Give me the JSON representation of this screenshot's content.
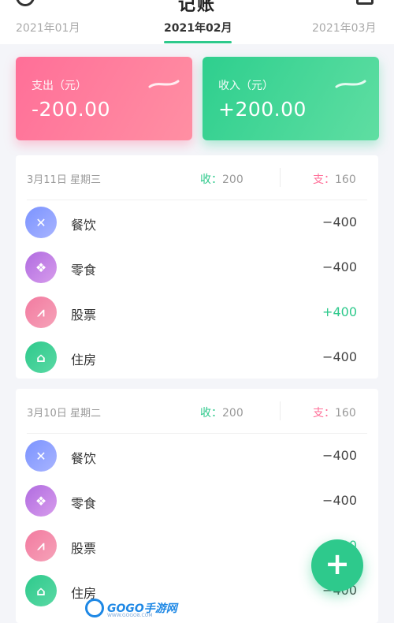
{
  "header": {
    "title": "记账",
    "tabs": [
      "2021年01月",
      "2021年02月",
      "2021年03月"
    ],
    "active_tab": 1
  },
  "summary": {
    "expense": {
      "label": "支出（元）",
      "value": "-200.00"
    },
    "income": {
      "label": "收入（元）",
      "value": "+200.00"
    }
  },
  "days": [
    {
      "date": "3月11日 星期三",
      "income_key": "收：",
      "income_val": "200",
      "expense_key": "支：",
      "expense_val": "160",
      "items": [
        {
          "label": "餐饮",
          "amount": "−400",
          "icon": "utensils-icon",
          "icon_glyph": "✕"
        },
        {
          "label": "零食",
          "amount": "−400",
          "icon": "candy-icon",
          "icon_glyph": "❖"
        },
        {
          "label": "股票",
          "amount": "+400",
          "icon": "stock-chart-icon",
          "icon_glyph": "⩘"
        },
        {
          "label": "住房",
          "amount": "−400",
          "icon": "house-icon",
          "icon_glyph": "⌂"
        }
      ]
    },
    {
      "date": "3月10日 星期二",
      "income_key": "收：",
      "income_val": "200",
      "expense_key": "支：",
      "expense_val": "160",
      "items": [
        {
          "label": "餐饮",
          "amount": "−400",
          "icon": "utensils-icon",
          "icon_glyph": "✕"
        },
        {
          "label": "零食",
          "amount": "−400",
          "icon": "candy-icon",
          "icon_glyph": "❖"
        },
        {
          "label": "股票",
          "amount": "+400",
          "icon": "stock-chart-icon",
          "icon_glyph": "⩘"
        },
        {
          "label": "住房",
          "amount": "−400",
          "icon": "house-icon",
          "icon_glyph": "⌂"
        }
      ]
    }
  ],
  "fab": {
    "glyph": "+"
  },
  "watermark": {
    "text": "GOGO手游网",
    "sub": "WWW.GOGO8.COM"
  },
  "colors": {
    "accent_green": "#2ec98c",
    "expense_pink": "#ff6f98"
  }
}
